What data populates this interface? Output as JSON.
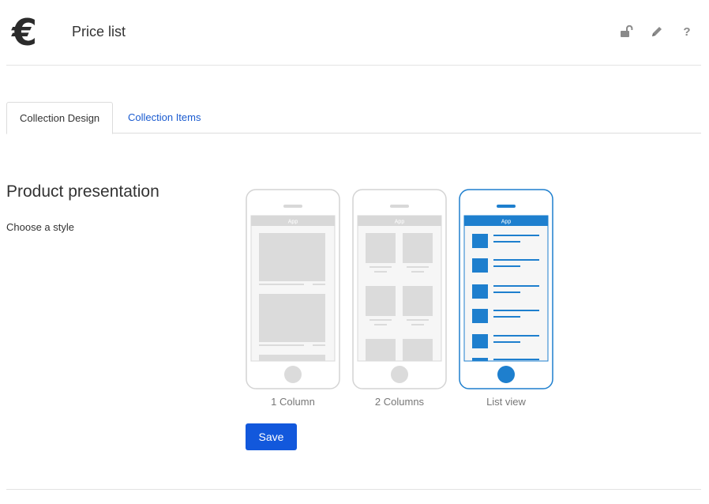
{
  "header": {
    "app_icon_glyph": "€",
    "title": "Price list",
    "actions": [
      {
        "icon": "unlock-icon",
        "label": ""
      },
      {
        "icon": "pencil-icon",
        "label": ""
      },
      {
        "icon": "help-icon",
        "label": "?"
      }
    ]
  },
  "tabs": [
    {
      "label": "Collection Design",
      "active": true
    },
    {
      "label": "Collection Items",
      "active": false
    }
  ],
  "section": {
    "title": "Product presentation",
    "subtitle": "Choose a style"
  },
  "styles": {
    "phone_header_text": "App",
    "options": [
      {
        "label": "1 Column",
        "selected": false
      },
      {
        "label": "2 Columns",
        "selected": false
      },
      {
        "label": "List view",
        "selected": true
      }
    ]
  },
  "save_label": "Save",
  "colors": {
    "accent": "#1E7FCE",
    "button": "#1258DC",
    "link": "#1A5BD0",
    "inactive_outline": "#D4D4D4"
  }
}
